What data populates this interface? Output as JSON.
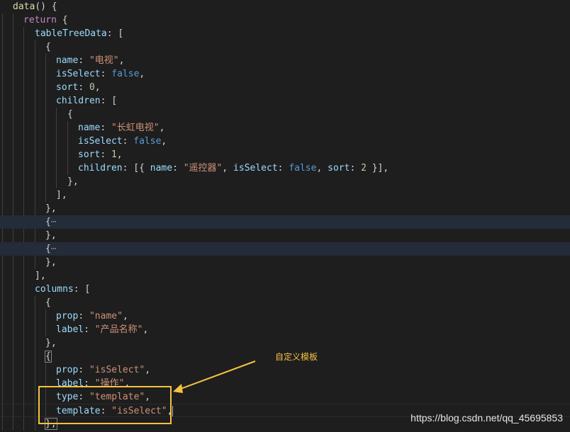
{
  "editor": {
    "lines": [
      [
        [
          "f",
          "data"
        ],
        [
          "d",
          "() {"
        ]
      ],
      [
        [
          "ctl",
          "return"
        ],
        [
          "d",
          " {"
        ]
      ],
      [
        [
          "p",
          "tableTreeData"
        ],
        [
          "d",
          ": ["
        ]
      ],
      [
        [
          "d",
          "{"
        ]
      ],
      [
        [
          "p",
          "name"
        ],
        [
          "d",
          ": "
        ],
        [
          "s",
          "\"电视\""
        ],
        [
          "d",
          ","
        ]
      ],
      [
        [
          "p",
          "isSelect"
        ],
        [
          "d",
          ": "
        ],
        [
          "k",
          "false"
        ],
        [
          "d",
          ","
        ]
      ],
      [
        [
          "p",
          "sort"
        ],
        [
          "d",
          ": "
        ],
        [
          "n",
          "0"
        ],
        [
          "d",
          ","
        ]
      ],
      [
        [
          "p",
          "children"
        ],
        [
          "d",
          ": ["
        ]
      ],
      [
        [
          "d",
          "{"
        ]
      ],
      [
        [
          "p",
          "name"
        ],
        [
          "d",
          ": "
        ],
        [
          "s",
          "\"长虹电视\""
        ],
        [
          "d",
          ","
        ]
      ],
      [
        [
          "p",
          "isSelect"
        ],
        [
          "d",
          ": "
        ],
        [
          "k",
          "false"
        ],
        [
          "d",
          ","
        ]
      ],
      [
        [
          "p",
          "sort"
        ],
        [
          "d",
          ": "
        ],
        [
          "n",
          "1"
        ],
        [
          "d",
          ","
        ]
      ],
      [
        [
          "p",
          "children"
        ],
        [
          "d",
          ": [{ "
        ],
        [
          "p",
          "name"
        ],
        [
          "d",
          ": "
        ],
        [
          "s",
          "\"遥控器\""
        ],
        [
          "d",
          ", "
        ],
        [
          "p",
          "isSelect"
        ],
        [
          "d",
          ": "
        ],
        [
          "k",
          "false"
        ],
        [
          "d",
          ", "
        ],
        [
          "p",
          "sort"
        ],
        [
          "d",
          ": "
        ],
        [
          "n",
          "2"
        ],
        [
          "d",
          " }],"
        ]
      ],
      [
        [
          "d",
          "},"
        ]
      ],
      [
        [
          "d",
          "],"
        ]
      ],
      [
        [
          "d",
          "},"
        ]
      ],
      [
        [
          "d",
          "{"
        ],
        [
          "ell",
          "⋯"
        ]
      ],
      [
        [
          "d",
          "},"
        ]
      ],
      [
        [
          "d",
          "{"
        ],
        [
          "ell",
          "⋯"
        ]
      ],
      [
        [
          "d",
          "},"
        ]
      ],
      [
        [
          "d",
          "],"
        ]
      ],
      [
        [
          "p",
          "columns"
        ],
        [
          "d",
          ": ["
        ]
      ],
      [
        [
          "d",
          "{"
        ]
      ],
      [
        [
          "p",
          "prop"
        ],
        [
          "d",
          ": "
        ],
        [
          "s",
          "\"name\""
        ],
        [
          "d",
          ","
        ]
      ],
      [
        [
          "p",
          "label"
        ],
        [
          "d",
          ": "
        ],
        [
          "s",
          "\"产品名称\""
        ],
        [
          "d",
          ","
        ]
      ],
      [
        [
          "d",
          "},"
        ]
      ],
      [
        [
          "d",
          "{"
        ]
      ],
      [
        [
          "p",
          "prop"
        ],
        [
          "d",
          ": "
        ],
        [
          "s",
          "\"isSelect\""
        ],
        [
          "d",
          ","
        ]
      ],
      [
        [
          "p",
          "label"
        ],
        [
          "d",
          ": "
        ],
        [
          "s",
          "\"操作\""
        ],
        [
          "d",
          ","
        ]
      ],
      [
        [
          "p",
          "type"
        ],
        [
          "d",
          ": "
        ],
        [
          "s",
          "\"template\""
        ],
        [
          "d",
          ","
        ]
      ],
      [
        [
          "p",
          "template"
        ],
        [
          "d",
          ": "
        ],
        [
          "s",
          "\"isSelect\""
        ],
        [
          "d",
          ","
        ]
      ],
      [
        [
          "d",
          "},"
        ]
      ]
    ]
  },
  "annotation": {
    "label": "自定义模板",
    "color": "#f5c242"
  },
  "watermark": "https://blog.csdn.net/qq_45695853"
}
